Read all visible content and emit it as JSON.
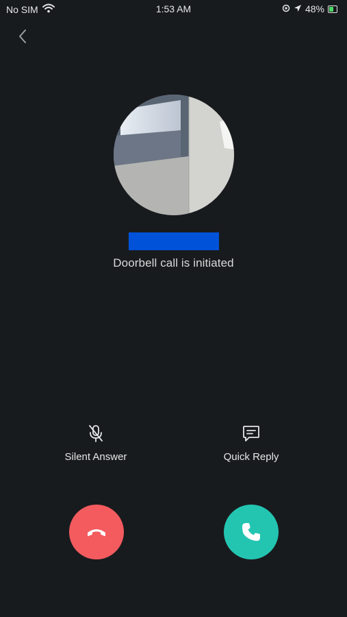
{
  "status_bar": {
    "carrier": "No SIM",
    "time": "1:53 AM",
    "battery": "48%",
    "battery_level": 0.48
  },
  "call": {
    "status_text": "Doorbell call is initiated"
  },
  "actions": {
    "silent_answer": "Silent Answer",
    "quick_reply": "Quick Reply"
  },
  "colors": {
    "background": "#181b1e",
    "decline": "#f35b5f",
    "accept": "#23c5b1",
    "redaction": "#0052d9"
  },
  "icons": {
    "back": "chevron-left-icon",
    "silent_answer": "mic-off-icon",
    "quick_reply": "chat-bubble-icon",
    "decline": "phone-hangup-icon",
    "accept": "phone-icon"
  }
}
